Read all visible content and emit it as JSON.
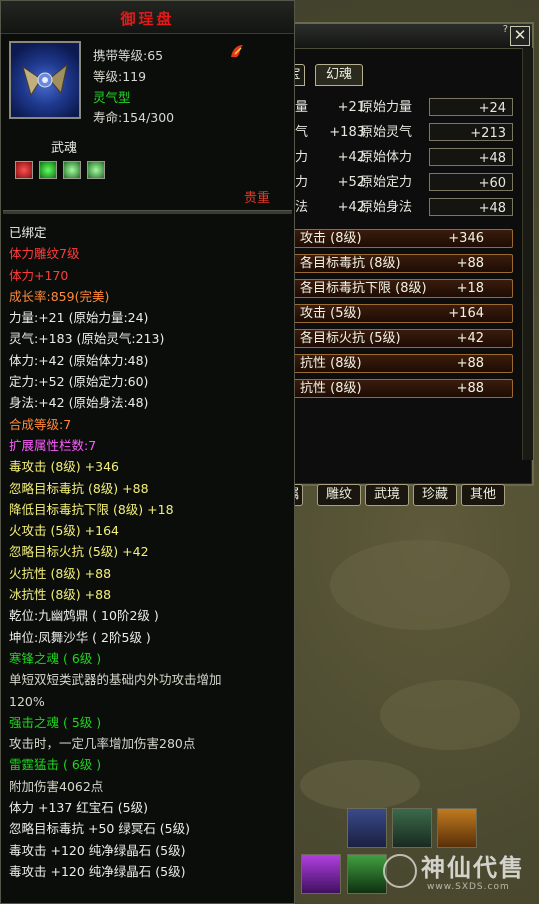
{
  "window": {
    "title": "御珵盘"
  },
  "item": {
    "carry_level": "携带等级:65",
    "level": "等级:119",
    "type": "灵气型",
    "lifespan": "寿命:154/300",
    "soul_label": "武魂",
    "rank": "贵重"
  },
  "tooltip_lines": [
    {
      "text": "已绑定",
      "color": "c-w"
    },
    {
      "text": "体力雕纹7级",
      "color": "c-r"
    },
    {
      "text": "体力+170",
      "color": "c-r"
    },
    {
      "text": "成长率:859(完美)",
      "color": "c-o"
    },
    {
      "text": "力量:+21 (原始力量:24)",
      "color": "c-w"
    },
    {
      "text": "灵气:+183 (原始灵气:213)",
      "color": "c-w"
    },
    {
      "text": "体力:+42 (原始体力:48)",
      "color": "c-w"
    },
    {
      "text": "定力:+52 (原始定力:60)",
      "color": "c-w"
    },
    {
      "text": "身法:+42 (原始身法:48)",
      "color": "c-w"
    },
    {
      "text": "合成等级:7",
      "color": "c-o"
    },
    {
      "text": "扩展属性栏数:7",
      "color": "c-m"
    },
    {
      "text": "毒攻击 (8级) +346",
      "color": "c-y"
    },
    {
      "text": "忽略目标毒抗 (8级) +88",
      "color": "c-y"
    },
    {
      "text": "降低目标毒抗下限 (8级) +18",
      "color": "c-y"
    },
    {
      "text": "火攻击 (5级) +164",
      "color": "c-y"
    },
    {
      "text": "忽略目标火抗 (5级) +42",
      "color": "c-y"
    },
    {
      "text": "火抗性 (8级) +88",
      "color": "c-y"
    },
    {
      "text": "冰抗性 (8级) +88",
      "color": "c-y"
    },
    {
      "text": "乾位:九幽鸩鼎 ( 10阶2级 )",
      "color": "c-w"
    },
    {
      "text": "坤位:凤舞沙华 ( 2阶5级 )",
      "color": "c-w"
    },
    {
      "text": "寒锋之魂 ( 6级 )",
      "color": "c-g"
    },
    {
      "text": "单短双短类武器的基础内外功攻击增加",
      "color": "c-gy"
    },
    {
      "text": "120%",
      "color": "c-gy"
    },
    {
      "text": "强击之魂 ( 5级 )",
      "color": "c-g"
    },
    {
      "text": "攻击时，一定几率增加伤害280点",
      "color": "c-gy"
    },
    {
      "text": "雷霆猛击 ( 6级 )",
      "color": "c-g"
    },
    {
      "text": "附加伤害4062点",
      "color": "c-gy"
    },
    {
      "text": "体力 +137 红宝石 (5级)",
      "color": "c-w"
    },
    {
      "text": "忽略目标毒抗 +50 绿冥石 (5级)",
      "color": "c-w"
    },
    {
      "text": "毒攻击 +120 纯净绿晶石 (5级)",
      "color": "c-w"
    },
    {
      "text": "毒攻击 +120 纯净绿晶石 (5级)",
      "color": "c-w"
    }
  ],
  "right_panel": {
    "help": "?",
    "close": "✕",
    "top_tabs": [
      "宝",
      "幻魂"
    ],
    "attr_rows": [
      {
        "lab": "量",
        "v": "+21",
        "lab2": "原始力量",
        "box": "+24"
      },
      {
        "lab": "气",
        "v": "+183",
        "lab2": "原始灵气",
        "box": "+213"
      },
      {
        "lab": "力",
        "v": "+42",
        "lab2": "原始体力",
        "box": "+48"
      },
      {
        "lab": "力",
        "v": "+52",
        "lab2": "原始定力",
        "box": "+60"
      },
      {
        "lab": "法",
        "v": "+42",
        "lab2": "原始身法",
        "box": "+48"
      }
    ],
    "stats": [
      {
        "n": "攻击 (8级)",
        "v": "+346"
      },
      {
        "n": "各目标毒抗 (8级)",
        "v": "+88"
      },
      {
        "n": "各目标毒抗下限 (8级)",
        "v": "+18"
      },
      {
        "n": "攻击 (5级)",
        "v": "+164"
      },
      {
        "n": "各目标火抗 (5级)",
        "v": "+42"
      },
      {
        "n": "抗性 (8级)",
        "v": "+88"
      },
      {
        "n": "抗性 (8级)",
        "v": "+88"
      }
    ],
    "bottom_tabs": [
      "属",
      "雕纹",
      "武境",
      "珍藏",
      "其他"
    ]
  },
  "watermark": {
    "text": "神仙代售",
    "url": "www.SXDS.com"
  },
  "colors": {
    "title_red": "#e21a1a",
    "green": "#26d626",
    "yellow": "#f4f07a",
    "orange": "#ff8a3c",
    "magenta": "#ff5cff"
  }
}
